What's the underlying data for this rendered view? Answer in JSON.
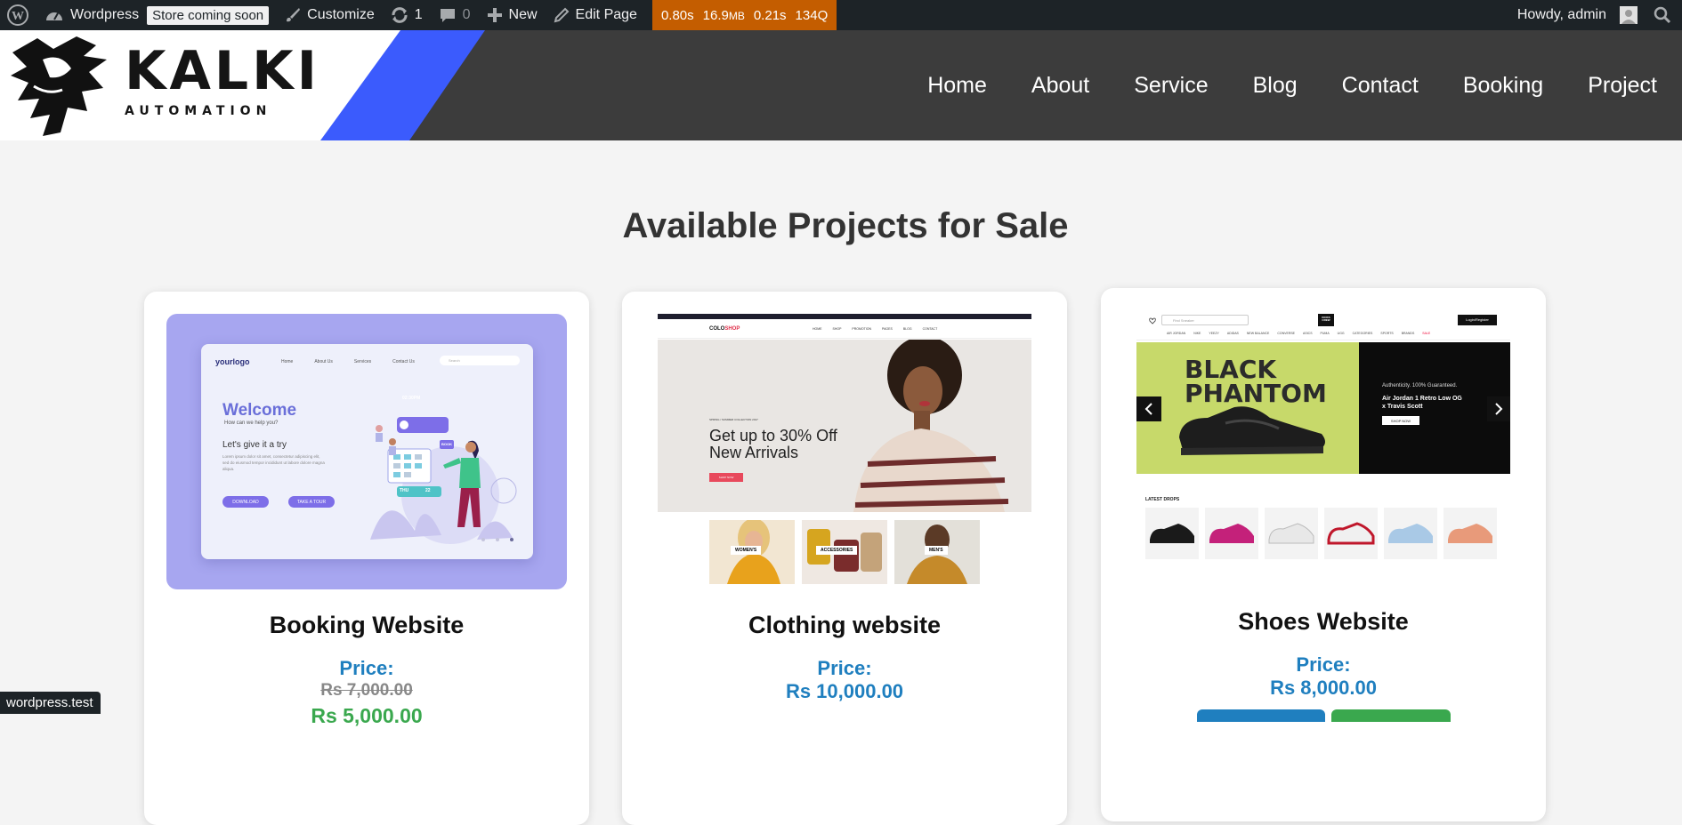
{
  "adminbar": {
    "site_name": "Wordpress",
    "store_badge": "Store coming soon",
    "customize": "Customize",
    "updates_count": "1",
    "comments_count": "0",
    "new_label": "New",
    "edit_page": "Edit Page",
    "qm_time": "0.80s",
    "qm_memory": "16.9",
    "qm_memory_unit": "MB",
    "qm_db_time": "0.21s",
    "qm_queries": "134Q",
    "howdy": "Howdy, admin"
  },
  "header": {
    "logo_title": "KALKI",
    "logo_subtitle": "AUTOMATION",
    "accent_color": "#3b5bfd",
    "nav": [
      "Home",
      "About",
      "Service",
      "Blog",
      "Contact",
      "Booking",
      "Project"
    ]
  },
  "main": {
    "title": "Available Projects for Sale",
    "projects": [
      {
        "title": "Booking Website",
        "price_label": "Price:",
        "old_price": "Rs 7,000.00",
        "sale_price": "Rs 5,000.00"
      },
      {
        "title": "Clothing website",
        "price_label": "Price:",
        "price": "Rs 10,000.00"
      },
      {
        "title": "Shoes Website",
        "price_label": "Price:",
        "price": "Rs 8,000.00"
      }
    ]
  },
  "thumbs": {
    "booking": {
      "logo": "yourlogo",
      "nav": [
        "Home",
        "About Us",
        "Services",
        "Contact Us"
      ],
      "search": "Search",
      "welcome": "Welcome",
      "tagline": "How can we help you?",
      "try": "Let's give it a try",
      "body": "Lorem ipsum dolor sit amet, consectetur adipiscing elit, sed do eiusmod tempor incididunt ut labore dolore magna aliqua.",
      "time": "02:30PM",
      "tag": "BOOK",
      "day": "THU",
      "date": "22",
      "btn1": "DOWNLOAD",
      "btn2": "TAKE A TOUR"
    },
    "clothing": {
      "logo_a": "COLO",
      "logo_b": "SHOP",
      "nav": [
        "HOME",
        "SHOP",
        "PROMOTION",
        "PAGES",
        "BLOG",
        "CONTACT"
      ],
      "kicker": "SPRING / SUMMER COLLECTION 2017",
      "headline1": "Get up to 30% Off",
      "headline2": "New Arrivals",
      "cta": "SHOP NOW",
      "cats": [
        "WOMEN'S",
        "ACCESSORIES",
        "MEN'S"
      ]
    },
    "shoes": {
      "search": "Find Sneaker",
      "logo": "KICKS CREW",
      "login": "Login/Register",
      "nav": [
        "AIR JORDAN",
        "NIKE",
        "YEEZY",
        "ADIDAS",
        "NEW BALANCE",
        "CONVERSE",
        "ASICS",
        "PUMA",
        "UGG",
        "CATEGORIES",
        "SPORTS",
        "BRANDS",
        "SALE"
      ],
      "hero_1": "BLACK",
      "hero_2": "PHANTOM",
      "auth": "Authenticity. 100% Guaranteed.",
      "product_1": "Air Jordan 1 Retro Low OG",
      "product_2": "x Travis Scott",
      "shop": "SHOP NOW",
      "latest": "LATEST DROPS"
    }
  },
  "status_url": "wordpress.test"
}
